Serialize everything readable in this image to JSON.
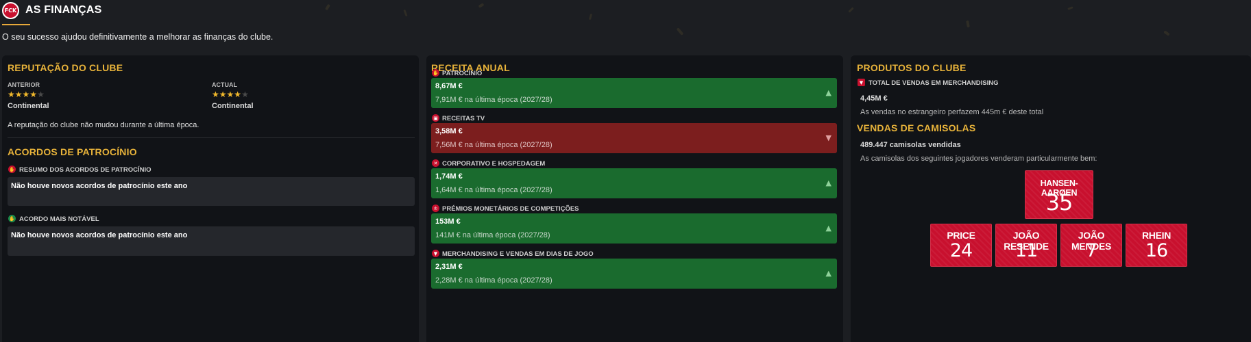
{
  "header": {
    "logo_text": "FCK",
    "title": "AS FINANÇAS",
    "subtitle": "O seu sucesso ajudou definitivamente a melhorar as finanças do clube."
  },
  "reputation": {
    "title": "REPUTAÇÃO DO CLUBE",
    "previous_label": "ANTERIOR",
    "previous_stars": 4,
    "previous_level": "Continental",
    "current_label": "ACTUAL",
    "current_stars": 4,
    "current_level": "Continental",
    "note": "A reputação do clube não mudou durante a última época."
  },
  "sponsorship": {
    "title": "ACORDOS DE PATROCÍNIO",
    "summary_label": "RESUMO DOS ACORDOS DE PATROCÍNIO",
    "summary_text": "Não houve novos acordos de patrocínio este ano",
    "notable_label": "ACORDO MAIS NOTÁVEL",
    "notable_text": "Não houve novos acordos de patrocínio este ano"
  },
  "revenue": {
    "title": "RECEITA ANUAL",
    "rows": [
      {
        "label": "PATROCÍNIO",
        "icon": "handshake-icon",
        "value": "8,67M €",
        "previous": "7,91M € na última época (2027/28)",
        "trend": "up"
      },
      {
        "label": "RECEITAS TV",
        "icon": "tv-icon",
        "value": "3,58M €",
        "previous": "7,56M € na última época (2027/28)",
        "trend": "down"
      },
      {
        "label": "CORPORATIVO E HOSPEDAGEM",
        "icon": "corporate-icon",
        "value": "1,74M €",
        "previous": "1,64M € na última época (2027/28)",
        "trend": "up"
      },
      {
        "label": "PRÉMIOS MONETÁRIOS DE COMPETIÇÕES",
        "icon": "trophy-icon",
        "value": "153M €",
        "previous": "141M € na última época (2027/28)",
        "trend": "up"
      },
      {
        "label": "MERCHANDISING E VENDAS EM DIAS DE JOGO",
        "icon": "shirt-icon",
        "value": "2,31M €",
        "previous": "2,28M € na última época (2027/28)",
        "trend": "up"
      }
    ],
    "up_arrow": "▲",
    "down_arrow": "▼"
  },
  "products": {
    "title": "PRODUTOS DO CLUBE",
    "merch_label": "TOTAL DE VENDAS EM MERCHANDISING",
    "merch_value": "4,45M €",
    "merch_note": "As vendas no estrangeiro perfazem 445m € deste total",
    "shirts_title": "VENDAS DE CAMISOLAS",
    "shirts_sold": "489.447 camisolas vendidas",
    "shirts_note": "As camisolas dos seguintes jogadores venderam particularmente bem:",
    "players": [
      {
        "name": "HANSEN-AARØEN",
        "number": "35"
      },
      {
        "name": "PRICE",
        "number": "24"
      },
      {
        "name": "JOÃO RESENDE",
        "number": "11"
      },
      {
        "name": "JOÃO MENDES",
        "number": "7"
      },
      {
        "name": "RHEIN",
        "number": "16"
      }
    ]
  },
  "colors": {
    "accent": "#e8b33a",
    "positive": "#1a6b2e",
    "negative": "#7c1e1e",
    "shirt": "#c8102e"
  }
}
